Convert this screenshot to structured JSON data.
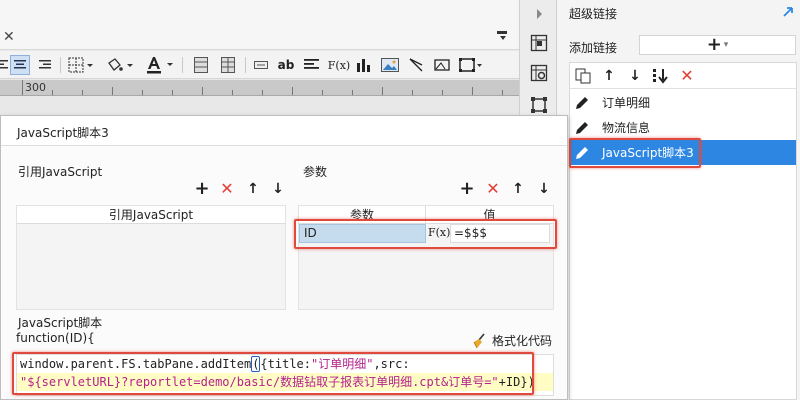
{
  "editor": {
    "ruler_value": "300"
  },
  "toolbar": {
    "text_style_label": "ab",
    "formula_label": "F(x)"
  },
  "hyperlink_panel": {
    "title": "超级链接",
    "add_link_label": "添加链接",
    "items": [
      {
        "label": "订单明细"
      },
      {
        "label": "物流信息"
      },
      {
        "label": "JavaScript脚本3",
        "selected": true
      }
    ]
  },
  "dialog": {
    "title": "JavaScript脚本3",
    "imported_js": {
      "section_label": "引用JavaScript",
      "column_header": "引用JavaScript"
    },
    "params": {
      "section_label": "参数",
      "headers": [
        "参数",
        "值"
      ],
      "rows": [
        {
          "name": "ID",
          "value": "=$$$"
        }
      ],
      "formula_label": "F(x)"
    },
    "script": {
      "section_label": "JavaScript脚本",
      "signature": "function(ID){",
      "format_button": "格式化代码",
      "code_line1_a": "window.parent.FS.tabPane.addItem",
      "code_line1_paren": "(",
      "code_line1_b": "{title:",
      "code_line1_str": "\"订单明细\"",
      "code_line1_c": ",src:",
      "code_line2_str": "\"${servletURL}?reportlet=demo/basic/数据钻取子报表订单明细.cpt&订单号=\"",
      "code_line2_tail": "+ID})"
    }
  },
  "colors": {
    "accent_blue": "#2d87e2",
    "highlight_red": "#e04a3c",
    "delete_red": "#e23e33",
    "string_magenta": "#b5228b"
  }
}
